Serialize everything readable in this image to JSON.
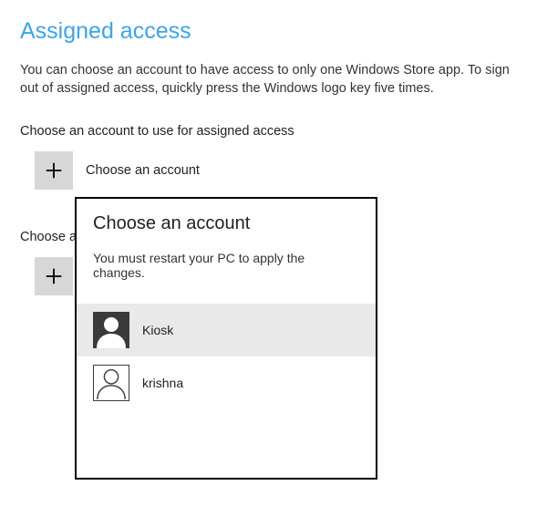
{
  "page": {
    "title": "Assigned access",
    "description": "You can choose an account to have access to only one Windows Store app. To sign out of assigned access, quickly press the Windows logo key five times.",
    "section_account_label": "Choose an account to use for assigned access",
    "choose_account_button": "Choose an account",
    "section_app_label_visible": "Choose a"
  },
  "popup": {
    "title": "Choose an account",
    "subtitle": "You must restart your PC to apply the changes.",
    "accounts": [
      {
        "name": "Kiosk",
        "selected": true
      },
      {
        "name": "krishna",
        "selected": false
      }
    ]
  }
}
